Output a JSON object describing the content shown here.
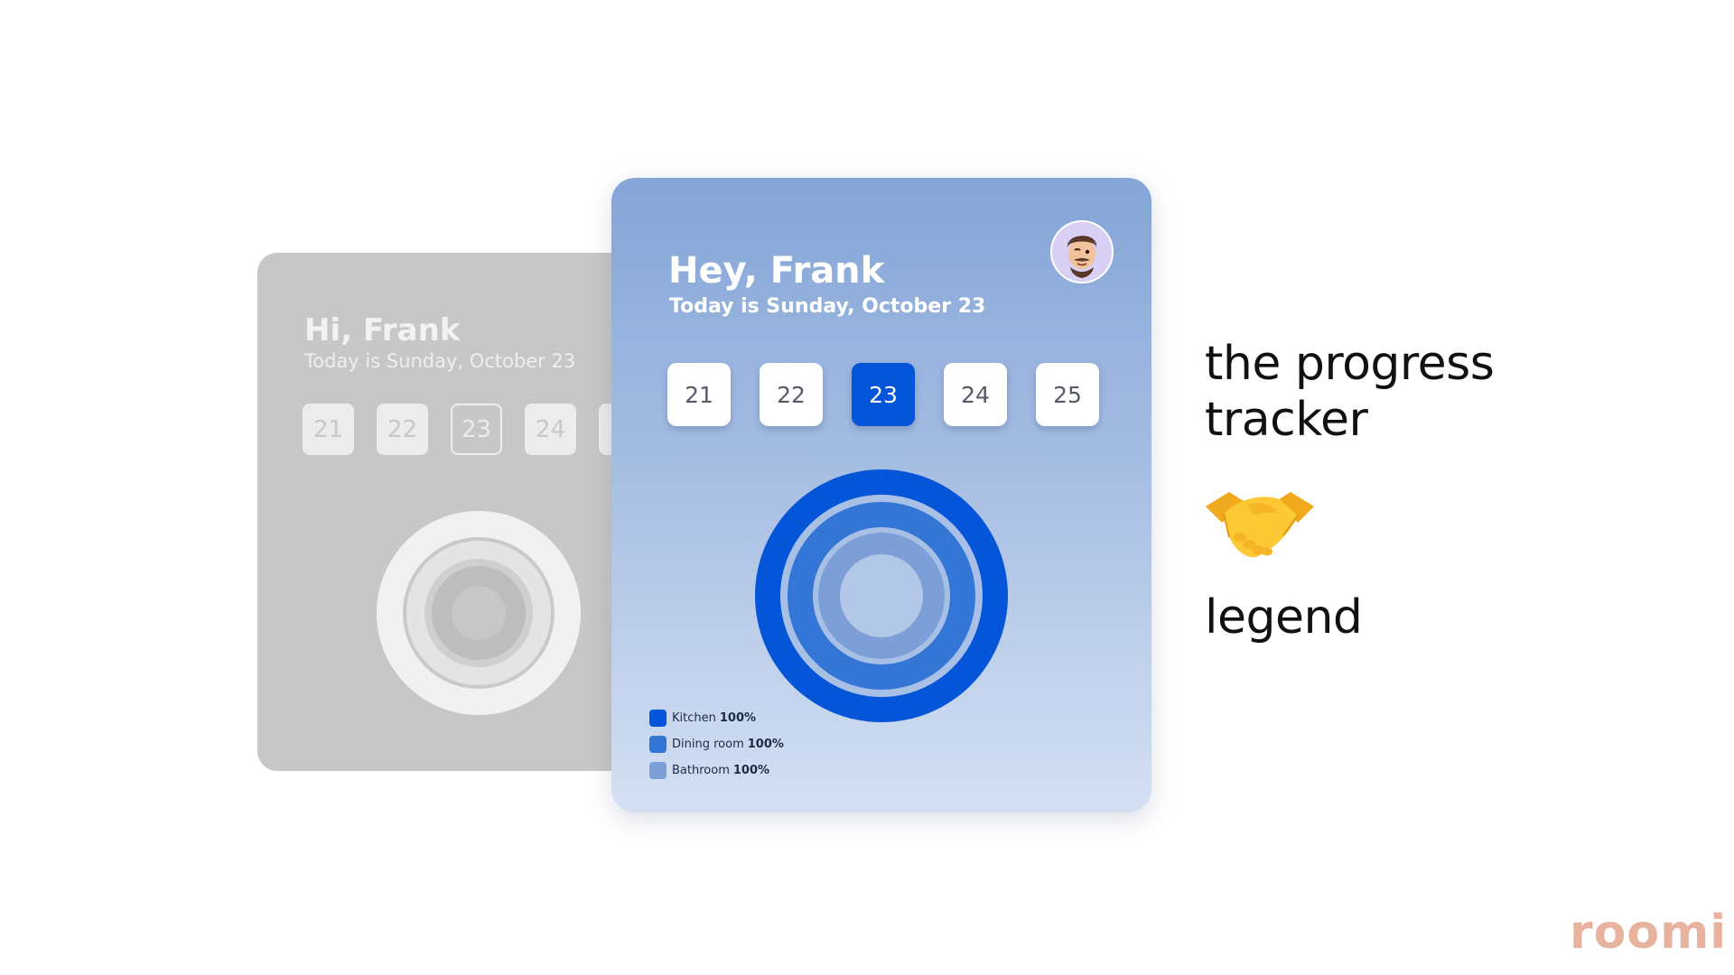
{
  "back_card": {
    "greeting": "Hi, Frank",
    "date_line": "Today is Sunday, October 23",
    "days": [
      "21",
      "22",
      "23",
      "24"
    ],
    "selected_day": "23"
  },
  "front_card": {
    "greeting": "Hey, Frank",
    "date_line": "Today is Sunday, October 23",
    "avatar_icon": "memoji-avatar-icon",
    "days": [
      "21",
      "22",
      "23",
      "24",
      "25"
    ],
    "selected_day": "23",
    "legend": [
      {
        "label": "Kitchen",
        "value": "100%",
        "color": "#0555d8"
      },
      {
        "label": "Dining room",
        "value": "100%",
        "color": "#3476d6"
      },
      {
        "label": "Bathroom",
        "value": "100%",
        "color": "#7d9fd8"
      }
    ]
  },
  "headline": "the progress tracker",
  "handshake_icon": "handshake-emoji-icon",
  "subheadline": "legend",
  "brand_logo": "roomi",
  "colors": {
    "accent": "#0555d8",
    "logo": "#e8b39e",
    "back_card": "#c7c7c7"
  }
}
